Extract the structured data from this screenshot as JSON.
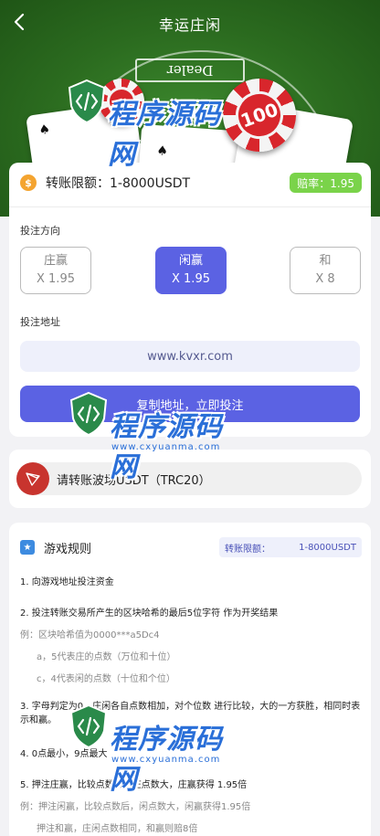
{
  "header": {
    "title": "幸运庄闲",
    "dealer_label": "Dealer",
    "chip_value": "100"
  },
  "watermark": {
    "cn": "程序源码网",
    "en": "www.cxyuanma.com"
  },
  "bet_panel": {
    "limit_label": "转账限额：1-8000USDT",
    "odds_label": "赔率：1.95",
    "direction_label": "投注方向",
    "options": [
      {
        "name": "庄赢",
        "odds": "X 1.95"
      },
      {
        "name": "闲赢",
        "odds": "X 1.95"
      },
      {
        "name": "和",
        "odds": "X 8"
      }
    ],
    "address_label": "投注地址",
    "address": "www.kvxr.com",
    "copy_button": "复制地址，立即投注"
  },
  "trc_panel": {
    "text": "请转账波场USDT（TRC20）"
  },
  "rules_panel": {
    "title": "游戏规则",
    "limit_key": "转账限额：",
    "limit_value": "1-8000USDT",
    "lines": [
      "1. 向游戏地址投注资金",
      "2. 投注转账交易所产生的区块哈希的最后5位字符 作为开奖结果",
      "例：区块哈希值为0000***a5Dc4",
      "a，5代表庄的点数（万位和十位）",
      "c，4代表闲的点数（十位和个位）",
      "3. 字母判定为0，庄闲各自点数相加，对个位数 进行比较，大的一方获胜，相同时表示和赢。",
      "4. 0点最小，9点最大",
      "5. 押注庄赢，比较点数后，庄点数大，庄赢获得 1.95倍",
      "例：押注闲赢，比较点数后，闲点数大，闲赢获得1.95倍",
      "押注和赢，庄闲点数相同，和赢则赔8倍"
    ]
  },
  "colors": {
    "accent": "#5b62e3",
    "felt": "#2b6b1f",
    "odds_badge": "#7ad34a",
    "trc_red": "#c8342e"
  }
}
